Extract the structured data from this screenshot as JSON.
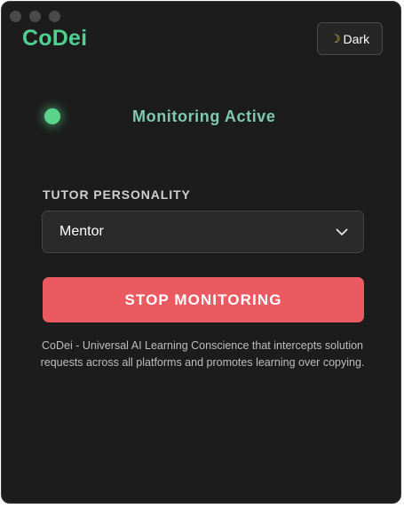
{
  "app": {
    "logo": "CoDei"
  },
  "header": {
    "theme_icon": "moon-icon",
    "theme_label": "Dark"
  },
  "status": {
    "text": "Monitoring Active",
    "indicator_color": "#5ad48a"
  },
  "personality": {
    "label": "TUTOR PERSONALITY",
    "selected": "Mentor"
  },
  "actions": {
    "stop_label": "STOP MONITORING"
  },
  "footer": {
    "description": "CoDei - Universal AI Learning Conscience that intercepts solution requests across all platforms and promotes learning over copying."
  },
  "colors": {
    "accent": "#4fd08f",
    "danger": "#ec5a61",
    "background": "#1c1c1c"
  }
}
